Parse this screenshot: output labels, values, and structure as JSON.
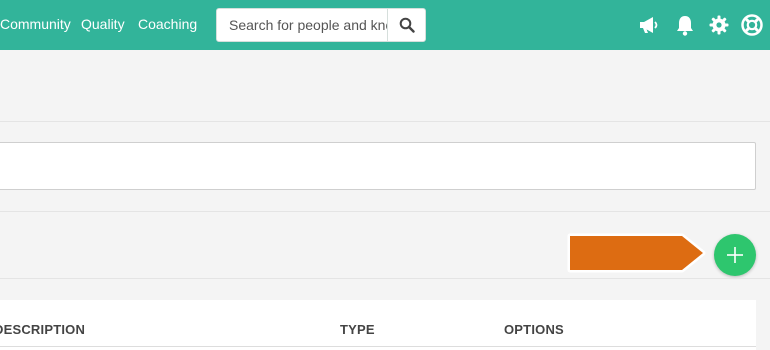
{
  "nav": {
    "items": [
      {
        "label": "Community"
      },
      {
        "label": "Quality"
      },
      {
        "label": "Coaching"
      }
    ]
  },
  "search": {
    "placeholder": "Search for people and knowledge",
    "icon": "search-icon"
  },
  "header_icons": [
    {
      "name": "megaphone-icon"
    },
    {
      "name": "bell-icon"
    },
    {
      "name": "gear-icon"
    },
    {
      "name": "lifebuoy-icon"
    }
  ],
  "add_button": {
    "icon": "plus-icon",
    "color": "#2ec66e"
  },
  "callout": {
    "color": "#dd6c12"
  },
  "table": {
    "headers": [
      "DESCRIPTION",
      "TYPE",
      "OPTIONS"
    ]
  },
  "colors": {
    "topbar": "#32b49a",
    "background": "#f4f4f4"
  }
}
